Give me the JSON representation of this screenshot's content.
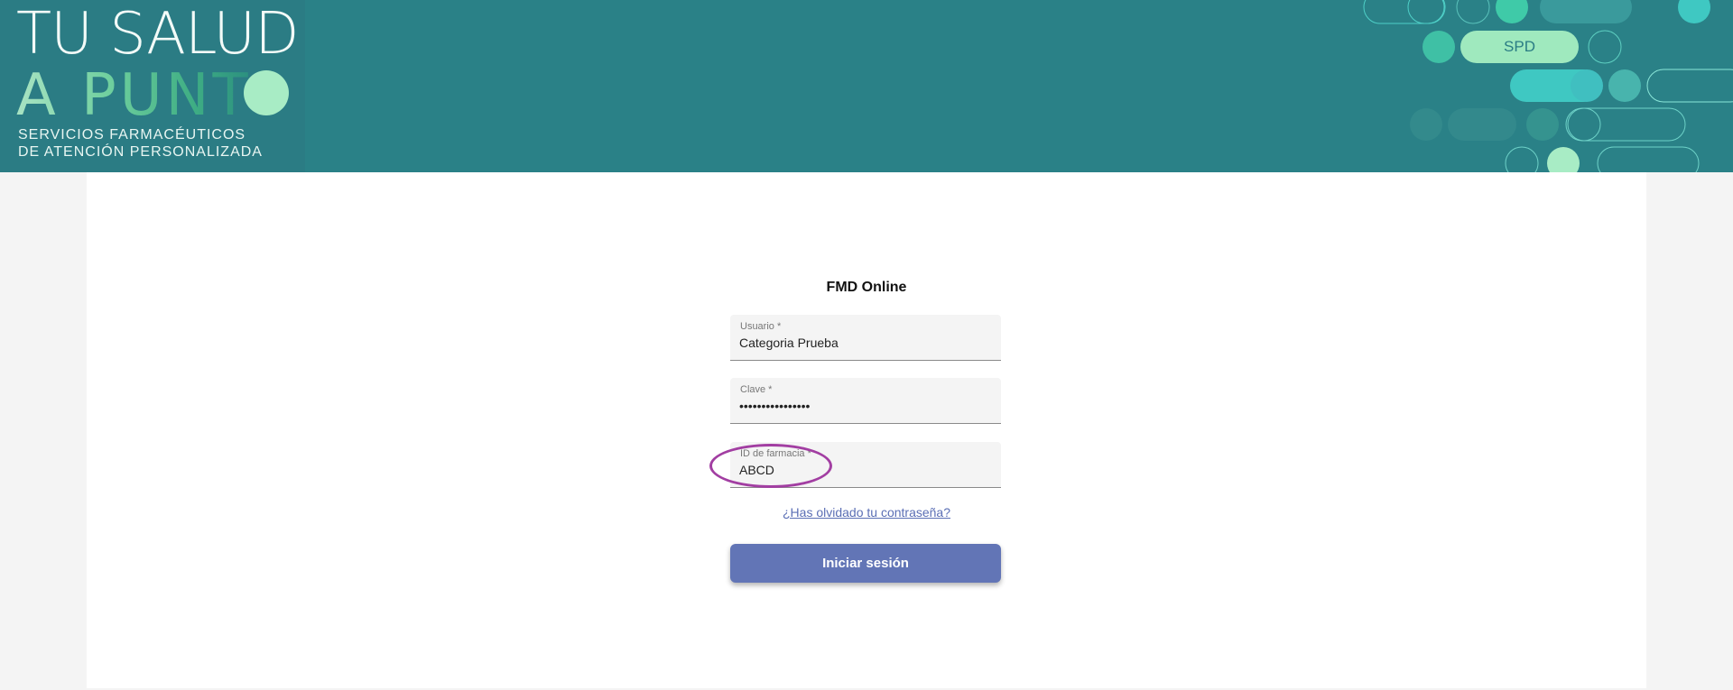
{
  "header": {
    "brand_line1": "TU SALUD",
    "brand_line2": "A PUNT",
    "tagline_line1": "SERVICIOS FARMACÉUTICOS",
    "tagline_line2": "DE ATENCIÓN PERSONALIZADA",
    "badge": "SPD",
    "colors": {
      "banner": "#2a8187",
      "mint": "#a8ecc5",
      "teal_accent": "#3fc8c2"
    }
  },
  "login": {
    "title": "FMD Online",
    "username": {
      "label": "Usuario *",
      "value": "Categoria Prueba"
    },
    "password": {
      "label": "Clave *",
      "value": "••••••••••••••••"
    },
    "pharmacy_id": {
      "label": "ID de farmacia *",
      "value": "ABCD"
    },
    "forgot_link": "¿Has olvidado tu contraseña?",
    "submit_label": "Iniciar sesión",
    "colors": {
      "button": "#6275b6",
      "link": "#5b6fb5",
      "highlight": "#a23ea2"
    }
  }
}
